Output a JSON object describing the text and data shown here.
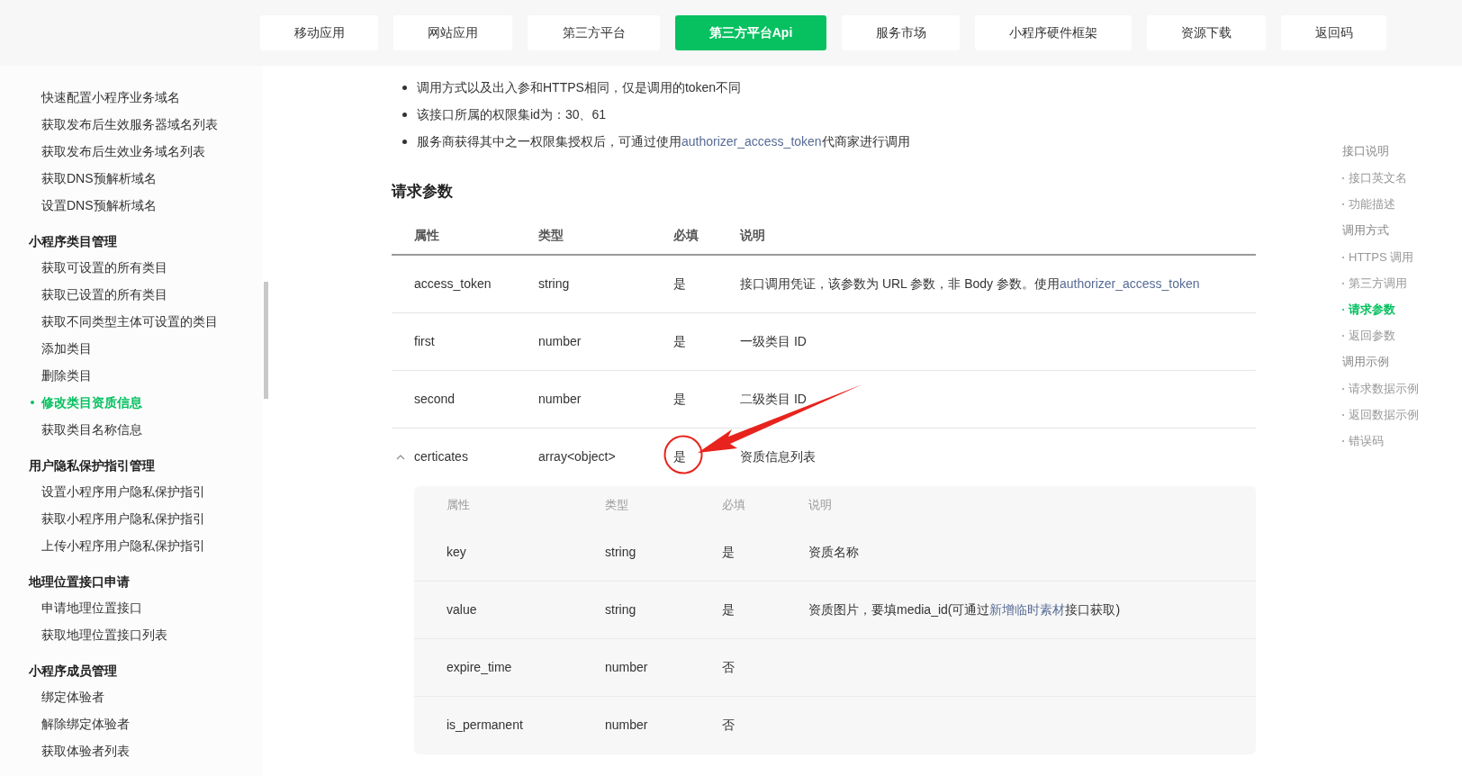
{
  "nav": [
    {
      "label": "移动应用",
      "selected": false
    },
    {
      "label": "网站应用",
      "selected": false
    },
    {
      "label": "第三方平台",
      "selected": false
    },
    {
      "label": "第三方平台Api",
      "selected": true
    },
    {
      "label": "服务市场",
      "selected": false
    },
    {
      "label": "小程序硬件框架",
      "selected": false
    },
    {
      "label": "资源下载",
      "selected": false
    },
    {
      "label": "返回码",
      "selected": false
    }
  ],
  "sidebar": [
    {
      "items": [
        {
          "label": "快速配置小程序业务域名",
          "selected": false
        },
        {
          "label": "获取发布后生效服务器域名列表",
          "selected": false
        },
        {
          "label": "获取发布后生效业务域名列表",
          "selected": false
        },
        {
          "label": "获取DNS预解析域名",
          "selected": false
        },
        {
          "label": "设置DNS预解析域名",
          "selected": false
        }
      ]
    },
    {
      "title": "小程序类目管理",
      "items": [
        {
          "label": "获取可设置的所有类目",
          "selected": false
        },
        {
          "label": "获取已设置的所有类目",
          "selected": false
        },
        {
          "label": "获取不同类型主体可设置的类目",
          "selected": false
        },
        {
          "label": "添加类目",
          "selected": false
        },
        {
          "label": "删除类目",
          "selected": false
        },
        {
          "label": "修改类目资质信息",
          "selected": true
        },
        {
          "label": "获取类目名称信息",
          "selected": false
        }
      ]
    },
    {
      "title": "用户隐私保护指引管理",
      "items": [
        {
          "label": "设置小程序用户隐私保护指引",
          "selected": false
        },
        {
          "label": "获取小程序用户隐私保护指引",
          "selected": false
        },
        {
          "label": "上传小程序用户隐私保护指引",
          "selected": false
        }
      ]
    },
    {
      "title": "地理位置接口申请",
      "items": [
        {
          "label": "申请地理位置接口",
          "selected": false
        },
        {
          "label": "获取地理位置接口列表",
          "selected": false
        }
      ]
    },
    {
      "title": "小程序成员管理",
      "items": [
        {
          "label": "绑定体验者",
          "selected": false
        },
        {
          "label": "解除绑定体验者",
          "selected": false
        },
        {
          "label": "获取体验者列表",
          "selected": false
        }
      ]
    }
  ],
  "notes": [
    [
      {
        "text": "调用方式以及出入参和HTTPS相同，仅是调用的token不同"
      }
    ],
    [
      {
        "text": "该接口所属的权限集id为：30、61"
      }
    ],
    [
      {
        "text": "服务商获得其中之一权限集授权后，可通过使用"
      },
      {
        "text": "authorizer_access_token",
        "link": true
      },
      {
        "text": "代商家进行调用"
      }
    ]
  ],
  "section_title": "请求参数",
  "params": {
    "columns": [
      "属性",
      "类型",
      "必填",
      "说明"
    ],
    "rows": [
      {
        "name": "access_token",
        "type": "string",
        "required": "是",
        "description": [
          {
            "text": "接口调用凭证，该参数为 URL 参数，非 Body 参数。使用"
          },
          {
            "text": "authorizer_access_token",
            "link": true
          }
        ]
      },
      {
        "name": "first",
        "type": "number",
        "required": "是",
        "description": [
          {
            "text": "一级类目 ID"
          }
        ]
      },
      {
        "name": "second",
        "type": "number",
        "required": "是",
        "description": [
          {
            "text": "二级类目 ID"
          }
        ]
      },
      {
        "name": "certicates",
        "type": "array<object>",
        "required": "是",
        "description": [
          {
            "text": "资质信息列表"
          }
        ],
        "expanded": true,
        "sub_columns": [
          "属性",
          "类型",
          "必填",
          "说明"
        ],
        "children": [
          {
            "name": "key",
            "type": "string",
            "required": "是",
            "description": [
              {
                "text": "资质名称"
              }
            ]
          },
          {
            "name": "value",
            "type": "string",
            "required": "是",
            "description": [
              {
                "text": "资质图片，要填media_id(可通过"
              },
              {
                "text": "新增临时素材",
                "link": true
              },
              {
                "text": "接口获取)"
              }
            ]
          },
          {
            "name": "expire_time",
            "type": "number",
            "required": "否"
          },
          {
            "name": "is_permanent",
            "type": "number",
            "required": "否"
          }
        ]
      }
    ]
  },
  "toc": [
    {
      "label": "接口说明",
      "selected": false,
      "children": [
        {
          "label": "接口英文名",
          "selected": false
        },
        {
          "label": "功能描述",
          "selected": false
        }
      ]
    },
    {
      "label": "调用方式",
      "selected": false,
      "children": [
        {
          "label": "HTTPS 调用",
          "selected": false
        },
        {
          "label": "第三方调用",
          "selected": false
        },
        {
          "label": "请求参数",
          "selected": true
        },
        {
          "label": "返回参数",
          "selected": false
        }
      ]
    },
    {
      "label": "调用示例",
      "selected": false,
      "children": [
        {
          "label": "请求数据示例",
          "selected": false
        },
        {
          "label": "返回数据示例",
          "selected": false
        },
        {
          "label": "错误码",
          "selected": false
        }
      ]
    }
  ]
}
